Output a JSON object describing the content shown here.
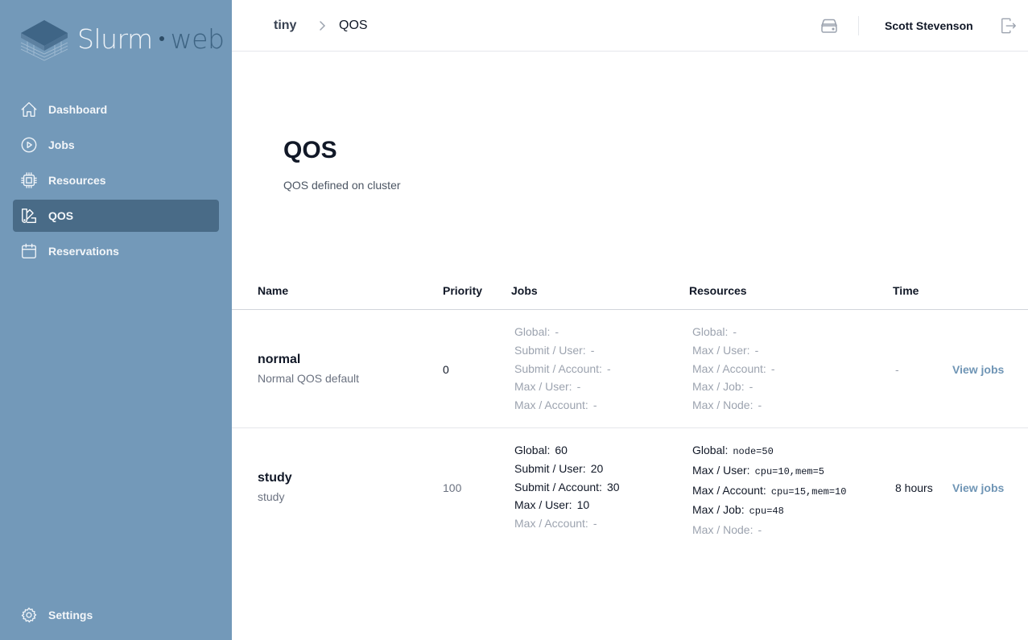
{
  "app": {
    "logo_text_main": "Slurm",
    "logo_text_web": "web",
    "brand_color": "#7399b9",
    "active_color": "#496b87",
    "link_color": "#6f95b5"
  },
  "sidebar": {
    "items": [
      {
        "label": "Dashboard",
        "icon": "home-icon"
      },
      {
        "label": "Jobs",
        "icon": "play-circle-icon"
      },
      {
        "label": "Resources",
        "icon": "cpu-chip-icon"
      },
      {
        "label": "QOS",
        "icon": "swatch-icon",
        "active": true
      },
      {
        "label": "Reservations",
        "icon": "calendar-icon"
      }
    ],
    "settings_label": "Settings"
  },
  "header": {
    "cluster": "tiny",
    "page": "QOS",
    "user": "Scott Stevenson"
  },
  "main": {
    "title": "QOS",
    "description": "QOS defined on cluster"
  },
  "table": {
    "columns": [
      "Name",
      "Priority",
      "Jobs",
      "Resources",
      "Time"
    ],
    "rows": [
      {
        "name": "normal",
        "description": "Normal QOS default",
        "priority": "0",
        "jobs": [
          {
            "label": "Global:",
            "value": "-"
          },
          {
            "label": "Submit / User:",
            "value": "-"
          },
          {
            "label": "Submit / Account:",
            "value": "-"
          },
          {
            "label": "Max / User:",
            "value": "-"
          },
          {
            "label": "Max / Account:",
            "value": "-"
          }
        ],
        "resources": [
          {
            "label": "Global:",
            "value": "-"
          },
          {
            "label": "Max / User:",
            "value": "-"
          },
          {
            "label": "Max / Account:",
            "value": "-"
          },
          {
            "label": "Max / Job:",
            "value": "-"
          },
          {
            "label": "Max / Node:",
            "value": "-"
          }
        ],
        "time": "-",
        "action": "View jobs"
      },
      {
        "name": "study",
        "description": "study",
        "priority": "100",
        "jobs": [
          {
            "label": "Global:",
            "value": "60"
          },
          {
            "label": "Submit / User:",
            "value": "20"
          },
          {
            "label": "Submit / Account:",
            "value": "30"
          },
          {
            "label": "Max / User:",
            "value": "10"
          },
          {
            "label": "Max / Account:",
            "value": "-"
          }
        ],
        "resources": [
          {
            "label": "Global:",
            "value": "node=50"
          },
          {
            "label": "Max / User:",
            "value": "cpu=10,mem=5"
          },
          {
            "label": "Max / Account:",
            "value": "cpu=15,mem=10"
          },
          {
            "label": "Max / Job:",
            "value": "cpu=48"
          },
          {
            "label": "Max / Node:",
            "value": "-"
          }
        ],
        "time": "8 hours",
        "action": "View jobs"
      }
    ]
  }
}
